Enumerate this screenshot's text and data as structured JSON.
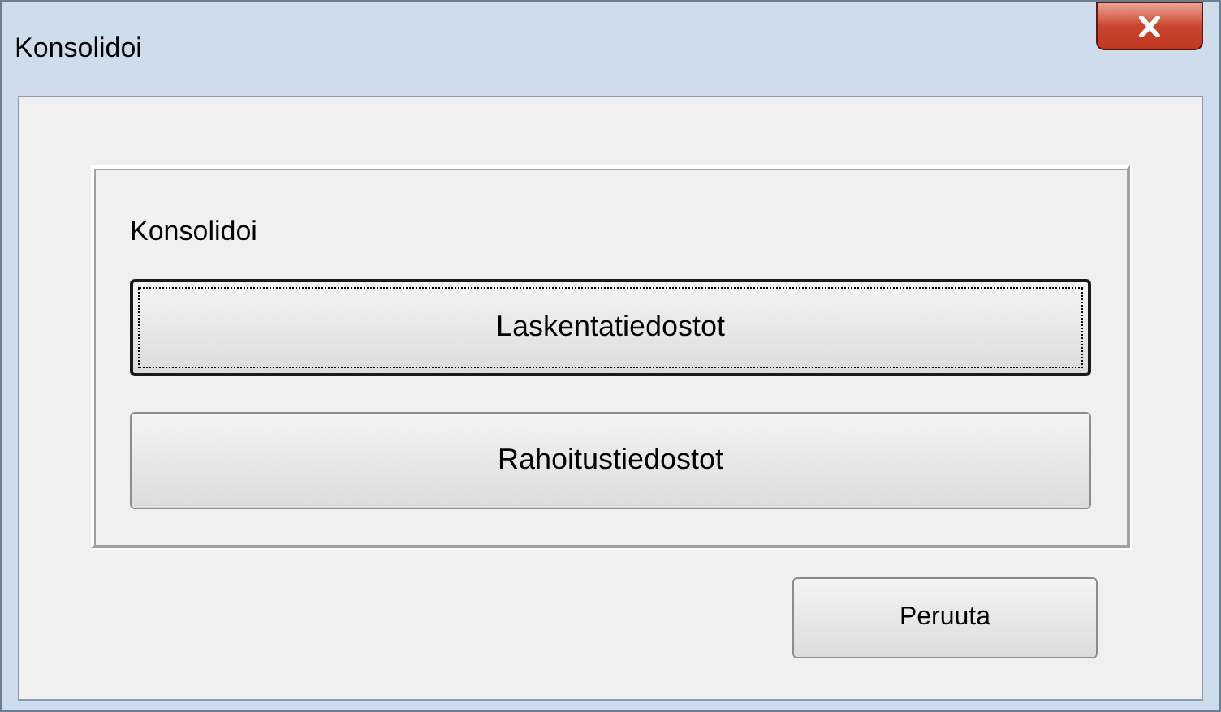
{
  "window": {
    "title": "Konsolidoi"
  },
  "group": {
    "label": "Konsolidoi",
    "buttons": [
      {
        "label": "Laskentatiedostot",
        "focused": true
      },
      {
        "label": "Rahoitustiedostot",
        "focused": false
      }
    ]
  },
  "cancel_button": {
    "label": "Peruuta"
  }
}
